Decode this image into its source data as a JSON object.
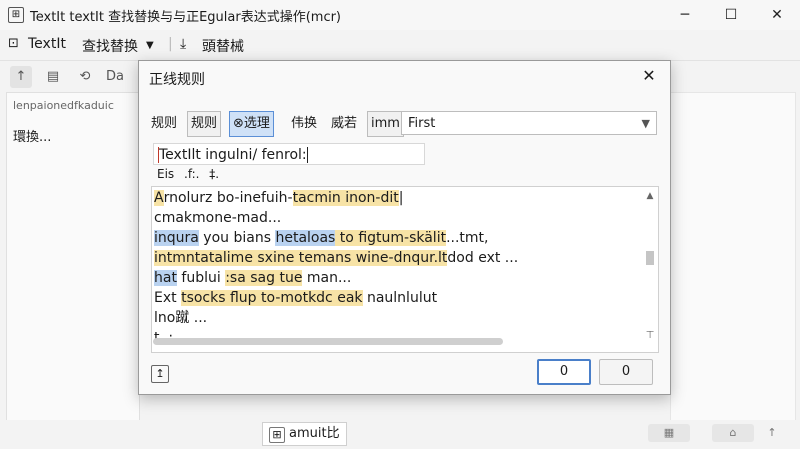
{
  "window": {
    "title": "TextIt textIt 查找替换与与正Egular表达式操作(mcr)",
    "controls": {
      "minimize": "─",
      "maximize": "☐",
      "close": "✕"
    }
  },
  "menubar": {
    "app_label": "TextIt",
    "find_replace_menu": "查找替换",
    "replace_item": "頭替械"
  },
  "toolbar": {
    "text_item": "Da"
  },
  "left_pane": {
    "line1": "lenpaionedfkaduic",
    "line2": "環換..."
  },
  "dialog": {
    "title": "正线规则",
    "options": [
      "规则",
      "规则",
      "⊗选理",
      "伟换",
      "威若",
      "imm"
    ],
    "select_value": "First",
    "pattern_value": "TextIlt ingulni/ fenrol:",
    "sub_labels": [
      "Eis",
      ".f:.",
      "‡."
    ],
    "result_lines": [
      [
        {
          "t": "A",
          "c": "hl-y"
        },
        {
          "t": "rnolurz bo-inefuih-",
          "c": ""
        },
        {
          "t": "tacmin inon-dit",
          "c": "hl-y"
        },
        {
          "t": "|",
          "c": ""
        },
        {
          "t": "  ",
          "": ""
        }
      ],
      [
        {
          "t": "cmakmone-mad...",
          "c": ""
        }
      ],
      [
        {
          "t": "inqura",
          "c": "hl-b"
        },
        {
          "t": " you bians ",
          "c": ""
        },
        {
          "t": "hetaloas",
          "c": "hl-b"
        },
        {
          "t": " to figtum-skälit",
          "c": "hl-y"
        },
        {
          "t": "...tmt,",
          "c": ""
        }
      ],
      [
        {
          "t": "intmntatalime sxine temans wine-dnqur.lt",
          "c": "hl-y"
        },
        {
          "t": "dod ext ...",
          "c": ""
        }
      ],
      [
        {
          "t": "hat",
          "c": "hl-b"
        },
        {
          "t": " fublui ",
          "c": ""
        },
        {
          "t": ":sa sag tue",
          "c": "hl-y"
        },
        {
          "t": " man...",
          "c": ""
        }
      ],
      [
        {
          "t": "Ext ",
          "c": ""
        },
        {
          "t": "tsocks flup to-motkdc eak",
          "c": "hl-y"
        },
        {
          "t": " naulnlulut",
          "c": ""
        }
      ],
      [
        {
          "t": "lno蹴 ...",
          "c": ""
        }
      ],
      [
        {
          "t": "t..: .",
          "c": ""
        }
      ]
    ],
    "buttons": {
      "ok": "0",
      "cancel": "0"
    }
  },
  "statusbar": {
    "center_text": "amuit比"
  }
}
